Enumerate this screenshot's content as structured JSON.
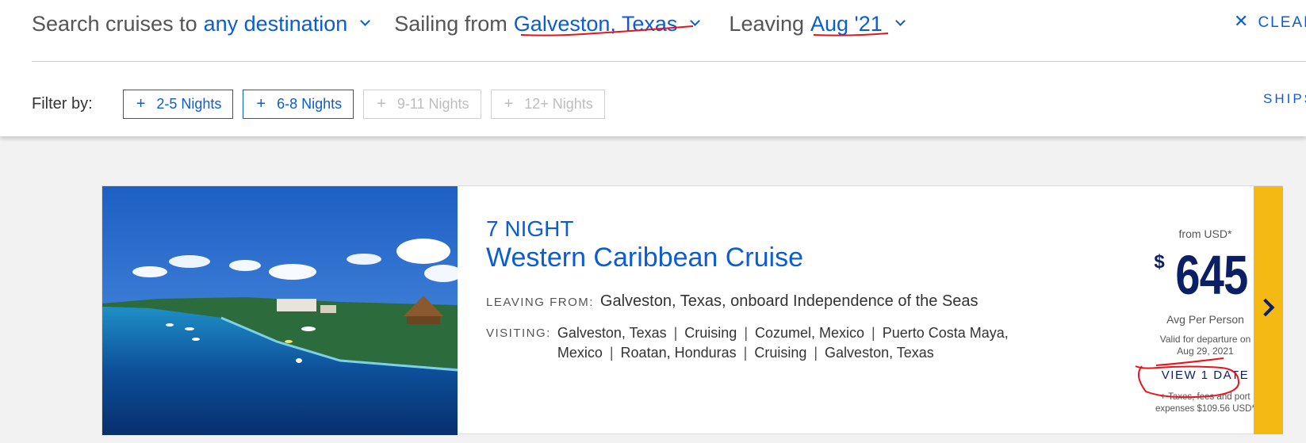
{
  "search": {
    "destination_prefix": "Search cruises to",
    "destination_value": "any destination",
    "port_prefix": "Sailing from",
    "port_value": "Galveston, Texas",
    "date_prefix": "Leaving",
    "date_value": "Aug '21",
    "clear_label": "CLEAR"
  },
  "filters": {
    "label": "Filter by:",
    "chips": [
      {
        "label": "2-5 Nights",
        "enabled": true
      },
      {
        "label": "6-8 Nights",
        "enabled": true
      },
      {
        "label": "9-11 Nights",
        "enabled": false
      },
      {
        "label": "12+ Nights",
        "enabled": false
      }
    ],
    "ships_label": "SHIPS"
  },
  "cruise": {
    "nights": "7 NIGHT",
    "title": "Western Caribbean Cruise",
    "leaving_label": "LEAVING FROM:",
    "leaving_value": "Galveston, Texas, onboard Independence of the Seas",
    "visiting_label": "VISITING:",
    "ports": [
      "Galveston, Texas",
      "Cruising",
      "Cozumel, Mexico",
      "Puerto Costa Maya, Mexico",
      "Roatan, Honduras",
      "Cruising",
      "Galveston, Texas"
    ],
    "from_label": "from USD*",
    "currency_symbol": "$",
    "price": "645",
    "avg_label": "Avg Per Person",
    "valid_line1": "Valid for departure on",
    "valid_line2": "Aug 29, 2021",
    "view_dates_label": "VIEW 1 DATE",
    "taxes_line1": "+ Taxes, fees and port",
    "taxes_line2": "expenses $109.56 USD*"
  },
  "colors": {
    "link_blue": "#0b5cd5",
    "price_navy": "#0b1f66",
    "accent_yellow": "#f5b914",
    "annotation_red": "#e8141b"
  },
  "icons": {
    "clear": "close-icon",
    "dropdowns": "chevron-down-icon",
    "chip": "plus-icon",
    "next": "chevron-right-icon"
  }
}
